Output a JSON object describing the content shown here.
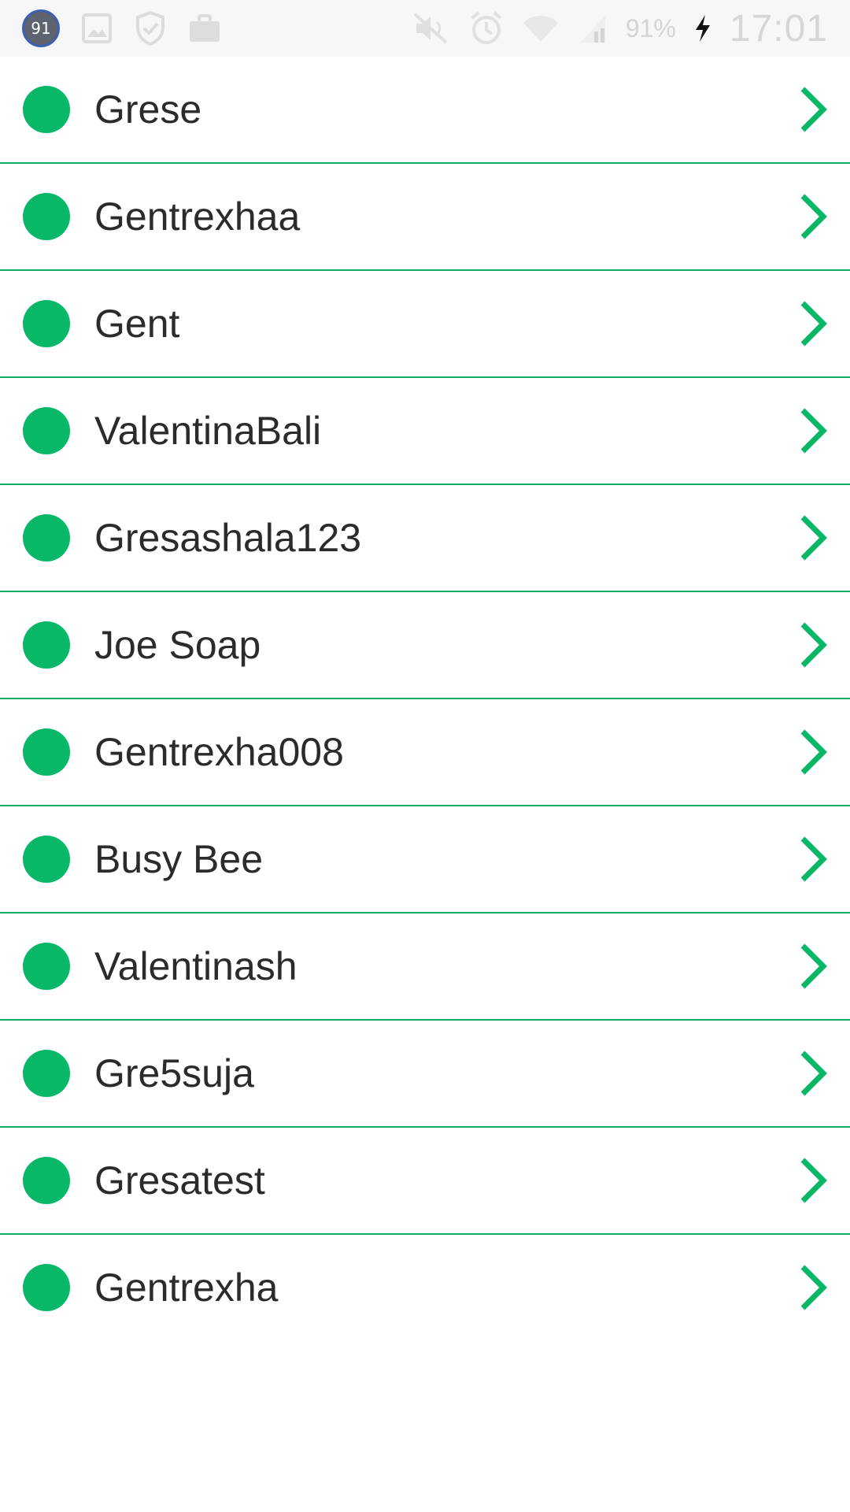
{
  "status_bar": {
    "notification_count": "91",
    "battery_percent": "91%",
    "time": "17:01",
    "icons": [
      "image-icon",
      "shield-check-icon",
      "briefcase-icon",
      "mute-icon",
      "alarm-icon",
      "wifi-icon",
      "signal-icon",
      "charging-bolt-icon"
    ]
  },
  "colors": {
    "accent": "#09b866",
    "divider": "#0aae62",
    "text": "#2b2b2b"
  },
  "users": [
    {
      "name": "Grese",
      "status": "online"
    },
    {
      "name": "Gentrexhaa",
      "status": "online"
    },
    {
      "name": "Gent",
      "status": "online"
    },
    {
      "name": "ValentinaBali",
      "status": "online"
    },
    {
      "name": "Gresashala123",
      "status": "online"
    },
    {
      "name": "Joe Soap",
      "status": "online"
    },
    {
      "name": "Gentrexha008",
      "status": "online"
    },
    {
      "name": "Busy Bee",
      "status": "online"
    },
    {
      "name": "Valentinash",
      "status": "online"
    },
    {
      "name": "Gre5suja",
      "status": "online"
    },
    {
      "name": "Gresatest",
      "status": "online"
    },
    {
      "name": "Gentrexha",
      "status": "online"
    }
  ]
}
